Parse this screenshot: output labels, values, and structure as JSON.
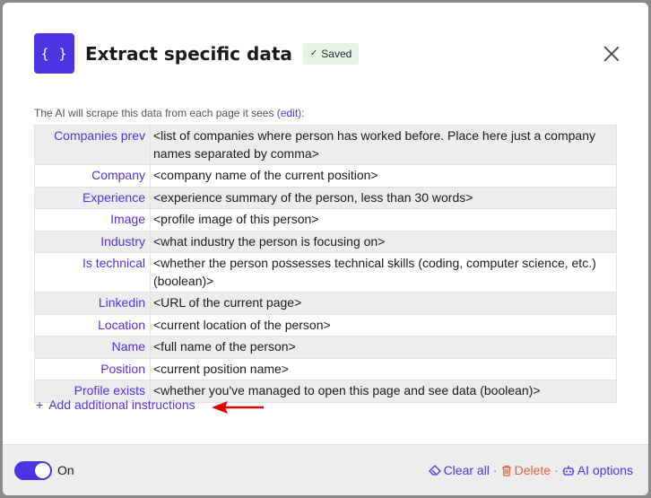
{
  "header": {
    "logo_text": "{ }",
    "title": "Extract specific data",
    "saved_label": "Saved"
  },
  "description": {
    "text_before": "The AI will scrape this data from each page it sees (",
    "edit_link": "edit",
    "text_after": "):"
  },
  "fields": [
    {
      "key": "Companies prev",
      "value": "<list of companies where person has worked before. Place here just a company names separated by comma>"
    },
    {
      "key": "Company",
      "value": "<company name of the current position>"
    },
    {
      "key": "Experience",
      "value": "<experience summary of the person, less than 30 words>"
    },
    {
      "key": "Image",
      "value": "<profile image of this person>"
    },
    {
      "key": "Industry",
      "value": "<what industry the person is focusing on>"
    },
    {
      "key": "Is technical",
      "value": "<whether the person possesses technical skills (coding, computer science, etc.) (boolean)>"
    },
    {
      "key": "Linkedin",
      "value": "<URL of the current page>"
    },
    {
      "key": "Location",
      "value": "<current location of the person>"
    },
    {
      "key": "Name",
      "value": "<full name of the person>"
    },
    {
      "key": "Position",
      "value": "<current position name>"
    },
    {
      "key": "Profile exists",
      "value": "<whether you've managed to open this page and see data (boolean)>"
    }
  ],
  "add_instructions": {
    "plus": "+",
    "label": "Add additional instructions"
  },
  "footer": {
    "toggle_state": "on",
    "toggle_label": "On",
    "clear_all": "Clear all",
    "delete": "Delete",
    "ai_options": "AI options",
    "separator": "·"
  },
  "colors": {
    "accent": "#4b34e3",
    "danger": "#e0613e",
    "arrow": "#e00000",
    "saved_bg": "#e5f3e5"
  },
  "icons": {
    "logo": "braces-icon",
    "saved": "check-icon",
    "close": "close-icon",
    "clear": "eraser-icon",
    "delete": "trash-icon",
    "ai_options": "robot-icon",
    "annotation": "red-arrow-icon"
  }
}
